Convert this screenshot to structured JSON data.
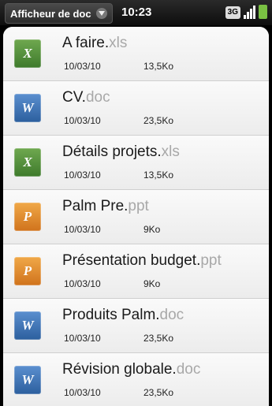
{
  "status_bar": {
    "app_menu_label": "Afficheur de doc",
    "time": "10:23",
    "network": "3G"
  },
  "files": [
    {
      "name": "A faire.",
      "ext": "xls",
      "type": "X",
      "kind": "xls",
      "date": "10/03/10",
      "size": "13,5Ko"
    },
    {
      "name": "CV.",
      "ext": "doc",
      "type": "W",
      "kind": "doc",
      "date": "10/03/10",
      "size": "23,5Ko"
    },
    {
      "name": "Détails projets.",
      "ext": "xls",
      "type": "X",
      "kind": "xls",
      "date": "10/03/10",
      "size": "13,5Ko"
    },
    {
      "name": "Palm Pre.",
      "ext": "ppt",
      "type": "P",
      "kind": "ppt",
      "date": "10/03/10",
      "size": "9Ko"
    },
    {
      "name": "Présentation budget.",
      "ext": "ppt",
      "type": "P",
      "kind": "ppt",
      "date": "10/03/10",
      "size": "9Ko"
    },
    {
      "name": "Produits Palm.",
      "ext": "doc",
      "type": "W",
      "kind": "doc",
      "date": "10/03/10",
      "size": "23,5Ko"
    },
    {
      "name": "Révision globale.",
      "ext": "doc",
      "type": "W",
      "kind": "doc",
      "date": "10/03/10",
      "size": "23,5Ko"
    }
  ],
  "colors": {
    "xls": "#4e8c39",
    "doc": "#3a70b4",
    "ppt": "#e08a2c",
    "battery": "#7ac143"
  }
}
